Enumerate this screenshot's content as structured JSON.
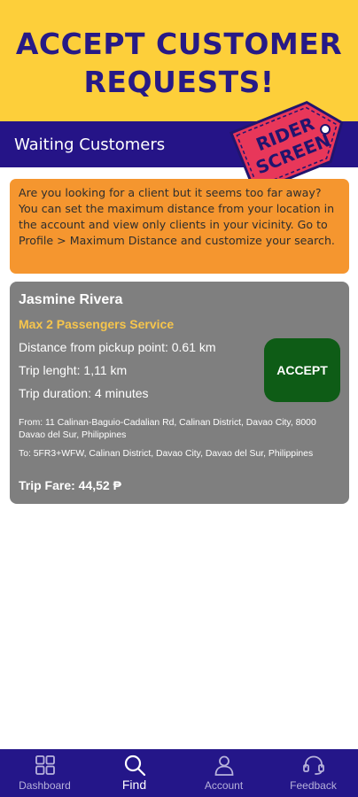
{
  "promo": {
    "line1": "ACCEPT CUSTOMER",
    "line2": "REQUESTS!"
  },
  "header": {
    "title": "Waiting Customers"
  },
  "tag": {
    "line1": "RIDER",
    "line2": "SCREEN",
    "color": "#e8375a"
  },
  "notice": {
    "text": "Are you looking for a client but it seems too far away? You can set the maximum distance from your location in the account and view only clients in your vicinity. Go to Profile > Maximum Distance and customize your search."
  },
  "request": {
    "customer_name": "Jasmine Rivera",
    "service": "Max 2 Passengers Service",
    "distance": "Distance from pickup point: 0.61 km",
    "trip_length": "Trip lenght: 1,11 km",
    "trip_duration": "Trip duration: 4 minutes",
    "from": "From: 11 Calinan-Baguio-Cadalian Rd, Calinan District, Davao City, 8000 Davao del Sur, Philippines",
    "to": "To: 5FR3+WFW, Calinan District, Davao City, Davao del Sur, Philippines",
    "fare": "Trip Fare: 44,52 ₱",
    "accept_label": "ACCEPT"
  },
  "nav": {
    "items": [
      {
        "label": "Dashboard",
        "icon": "dashboard-grid-icon",
        "active": false
      },
      {
        "label": "Find",
        "icon": "search-icon",
        "active": true
      },
      {
        "label": "Account",
        "icon": "person-icon",
        "active": false
      },
      {
        "label": "Feedback",
        "icon": "headset-icon",
        "active": false
      }
    ]
  },
  "colors": {
    "promo_bg": "#fdcf3a",
    "brand_navy": "#251487",
    "notice_bg": "#f5962f",
    "card_bg": "#7f7f7f",
    "service_text": "#f6c54c",
    "accept_bg": "#0e5c16"
  }
}
